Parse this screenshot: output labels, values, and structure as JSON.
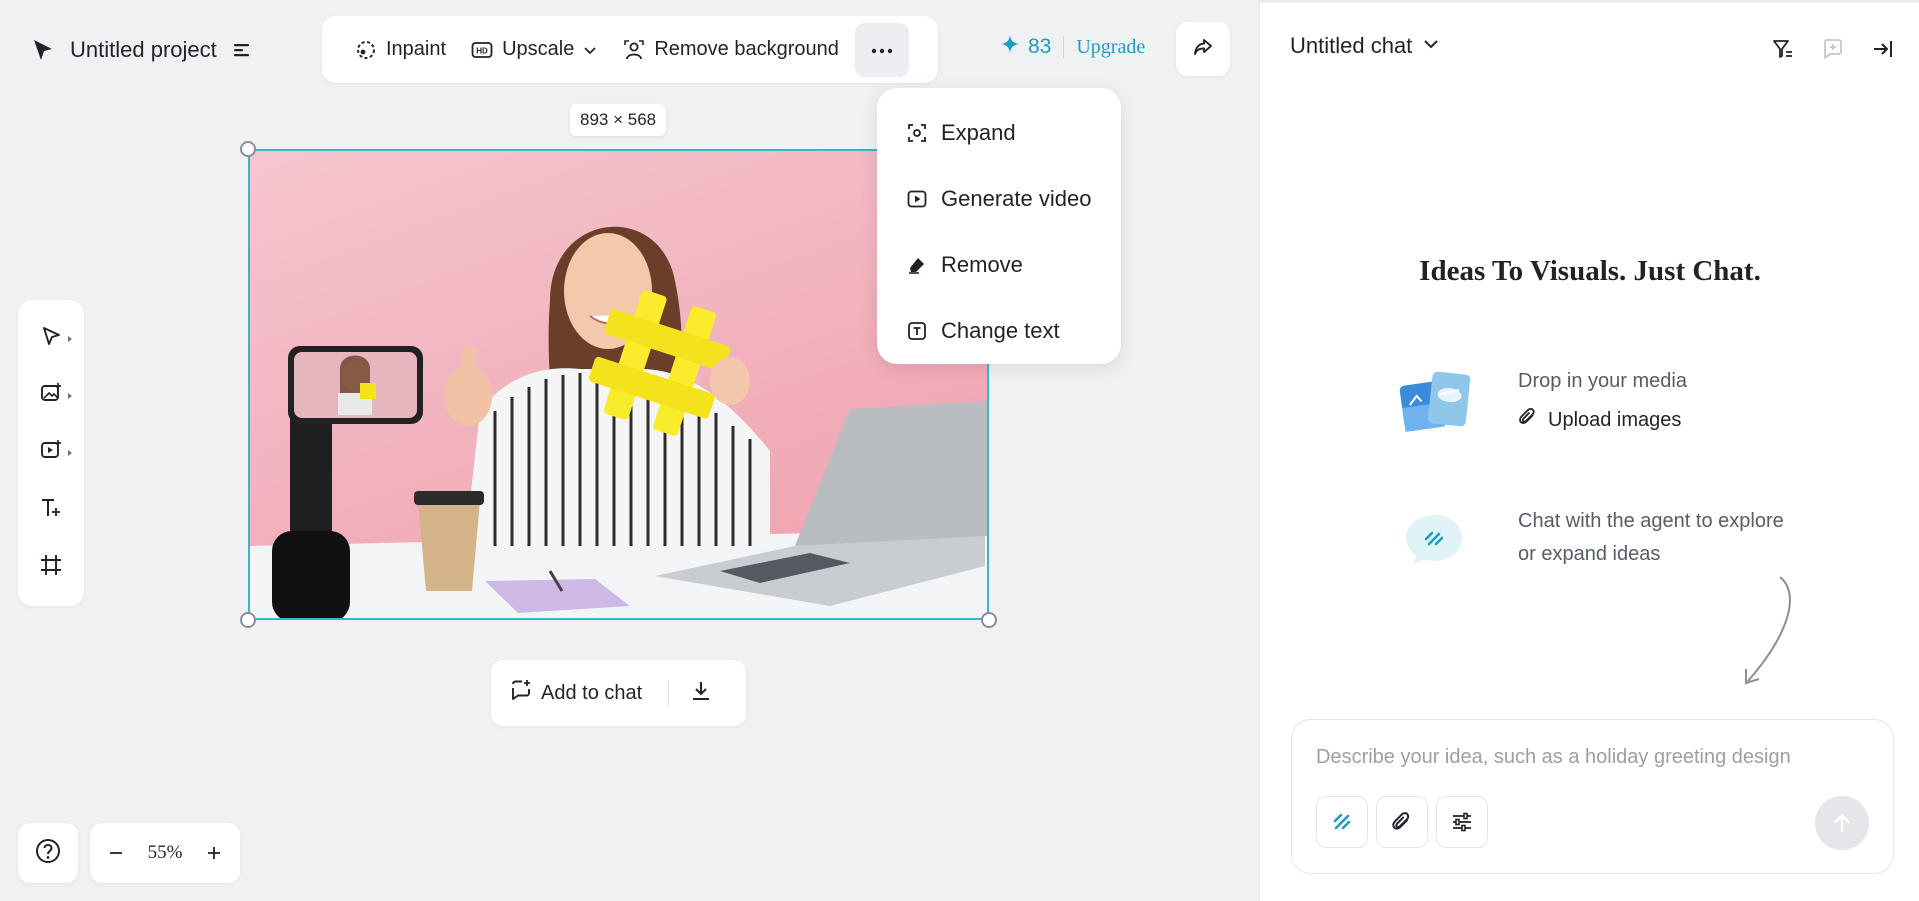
{
  "project": {
    "title": "Untitled project"
  },
  "toolbar": {
    "inpaint_label": "Inpaint",
    "upscale_label": "Upscale",
    "remove_bg_label": "Remove background"
  },
  "credits": {
    "count": "83",
    "upgrade_label": "Upgrade"
  },
  "canvas": {
    "image_size": "893 × 568",
    "zoom": "55%"
  },
  "more_menu": {
    "items": [
      {
        "label": "Expand",
        "icon": "expand-icon"
      },
      {
        "label": "Generate video",
        "icon": "play-icon"
      },
      {
        "label": "Remove",
        "icon": "eraser-icon"
      },
      {
        "label": "Change text",
        "icon": "text-box-icon"
      }
    ]
  },
  "image_actions": {
    "add_to_chat_label": "Add to chat"
  },
  "chat": {
    "title": "Untitled chat",
    "headline": "Ideas To Visuals. Just Chat.",
    "media_text": "Drop in your media",
    "upload_label": "Upload images",
    "agent_line1": "Chat with the agent to explore",
    "agent_line2": "or expand ideas",
    "input_placeholder": "Describe your idea, such as a holiday greeting design"
  },
  "colors": {
    "accent": "#1b9fbf",
    "selection": "#3ab5c8",
    "photo_bg": "#f1aeb9"
  }
}
